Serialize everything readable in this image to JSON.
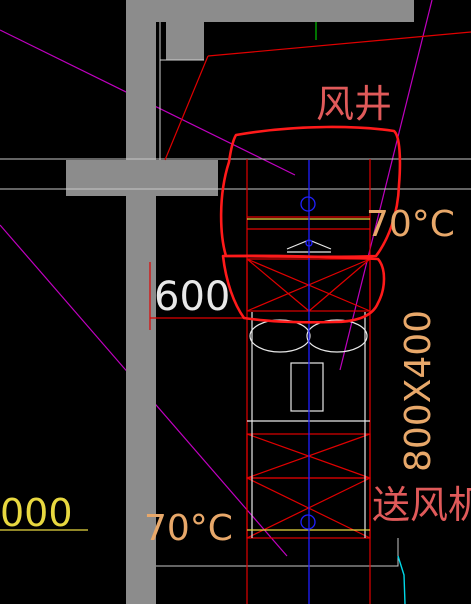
{
  "labels": {
    "shaft": "风井",
    "temp_top": "70°C",
    "temp_bottom": "70°C",
    "dimension": "600",
    "duct_size": "800X400",
    "supply_fan": "送风机",
    "left_partial": "000"
  },
  "colors": {
    "background": "#000000",
    "wall_fill": "#8c8c8c",
    "duct_red": "#e00000",
    "markup_red": "#ff1a1a",
    "magenta_line": "#c000c0",
    "green_line": "#00c000",
    "blue_axis": "#2020ff",
    "white_line": "#e8e8e8",
    "text_red": "#e05a5a",
    "text_orange": "#e8a86a",
    "text_yellow": "#e8d840",
    "cyan_line": "#00d8e8"
  }
}
